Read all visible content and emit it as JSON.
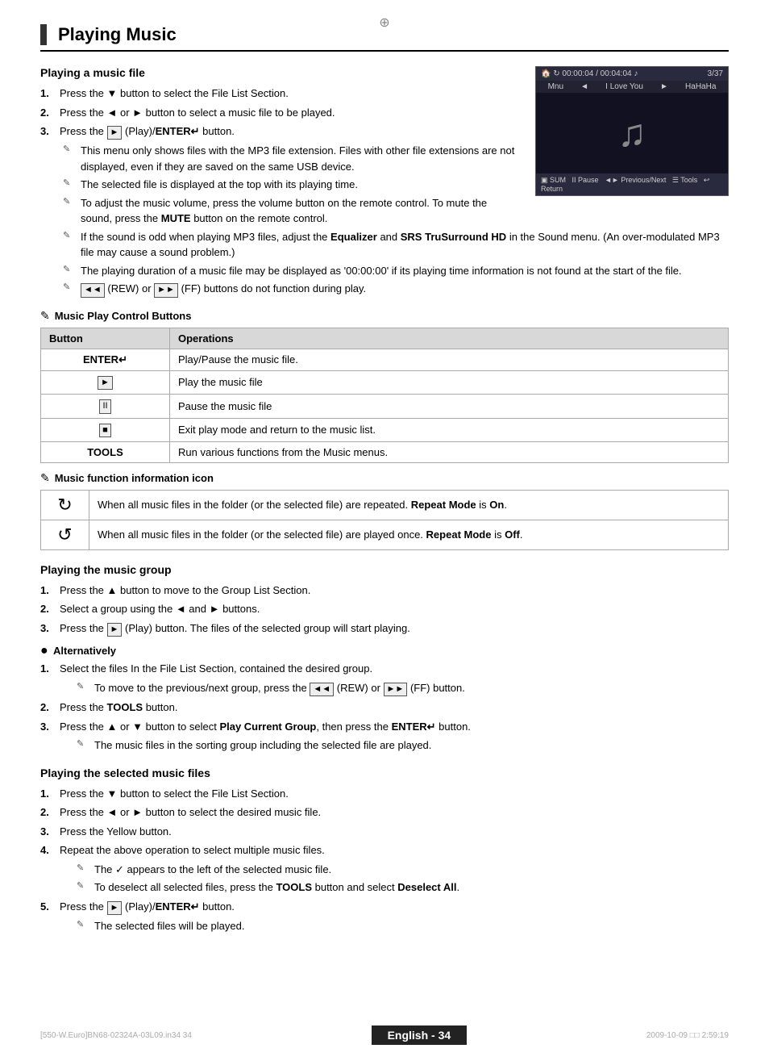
{
  "page": {
    "title": "Playing Music",
    "corner_marks": {
      "tl": "",
      "tr": "",
      "bl": "[550-W.Euro]BN68-02324A-03L09.in34   34",
      "br": "2009-10-09   □□ 2:59:19"
    },
    "center_symbol": "⊕"
  },
  "sections": {
    "playing_music_file": {
      "title": "Playing a music file",
      "steps": [
        "Press the ▼ button to select the File List Section.",
        "Press the ◄ or ► button to select a music file to be played.",
        "Press the ► (Play)/ENTER↵ button."
      ],
      "notes": [
        "This menu only shows files with the MP3 file extension. Files with other file extensions are not displayed, even if they are saved on the same USB device.",
        "The selected file is displayed at the top with its playing time.",
        "To adjust the music volume, press the volume button on the remote control. To mute the sound, press the MUTE button on the remote control.",
        "If the sound is odd when playing MP3 files, adjust the Equalizer and SRS TruSurround HD in the Sound menu. (An over-modulated MP3 file may cause a sound problem.)",
        "The playing duration of a music file may be displayed as '00:00:00' if its playing time information is not found at the start of the file.",
        "◄◄ (REW) or ►► (FF) buttons do not function during play."
      ]
    },
    "music_play_control_buttons": {
      "header": "Music Play Control Buttons",
      "columns": [
        "Button",
        "Operations"
      ],
      "rows": [
        {
          "button": "ENTER↵",
          "operation": "Play/Pause the music file."
        },
        {
          "button": "►",
          "operation": "Play the music file"
        },
        {
          "button": "II",
          "operation": "Pause the music file"
        },
        {
          "button": "■",
          "operation": "Exit play mode and return to the music list."
        },
        {
          "button": "TOOLS",
          "operation": "Run various functions from the Music menus."
        }
      ]
    },
    "music_function_info": {
      "header": "Music function information icon",
      "rows": [
        {
          "icon": "↻",
          "desc": "When all music files in the folder (or the selected file) are repeated. Repeat Mode is On."
        },
        {
          "icon": "↺",
          "desc": "When all music files in the folder (or the selected file) are played once. Repeat Mode is Off."
        }
      ]
    },
    "playing_music_group": {
      "title": "Playing the music group",
      "steps": [
        "Press the ▲ button to move to the Group List Section.",
        "Select a group using the ◄ and ► buttons.",
        "Press the ► (Play) button. The files of the selected group will start playing."
      ],
      "alternatively": {
        "label": "Alternatively",
        "steps": [
          "Select the files In the File List Section, contained the desired group.",
          "Press the TOOLS button.",
          "Press the ▲ or ▼ button to select Play Current Group, then press the ENTER↵ button."
        ],
        "notes": [
          "To move to the previous/next group, press the ◄◄ (REW) or ►► (FF) button.",
          "The music files in the sorting group including the selected file are played."
        ]
      }
    },
    "playing_selected_music_files": {
      "title": "Playing the selected music files",
      "steps": [
        "Press the ▼ button to select the File List Section.",
        "Press the ◄ or ► button to select the desired music file.",
        "Press the Yellow button.",
        "Repeat the above operation to select multiple music files.",
        "Press the ► (Play)/ENTER↵ button."
      ],
      "notes_step4": [
        "The ✓ appears to the left of the selected music file.",
        "To deselect all selected files, press the TOOLS button and select Deselect All."
      ],
      "notes_step5": [
        "The selected files will be played."
      ]
    }
  },
  "preview": {
    "top_bar_left": "🏠 ↻  00:00:04 / 00:04:04 ♪",
    "top_bar_right": "3/37",
    "nav_items": [
      "Mnu",
      "◄",
      "I Love You",
      "►",
      "HaHaHa"
    ],
    "bottom_bar": "SUM    II Pause  ◄► Previous / Next  ☰ Tools  ↩ Return"
  },
  "footer": {
    "left": "",
    "center": "English - 34",
    "right": ""
  }
}
